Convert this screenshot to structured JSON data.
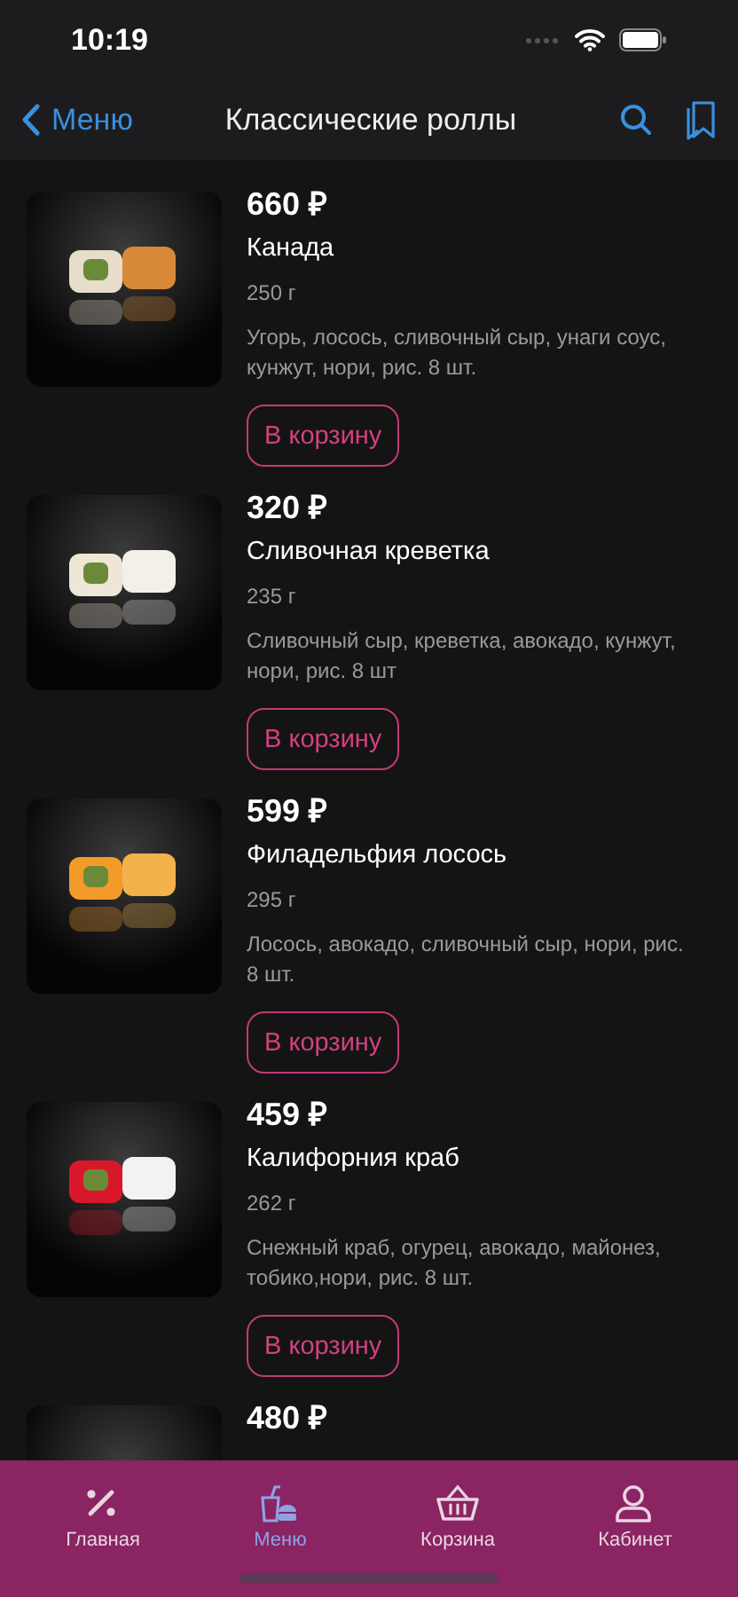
{
  "status_bar": {
    "time": "10:19"
  },
  "nav": {
    "back": "Меню",
    "title": "Классические роллы"
  },
  "products": [
    {
      "price": "660 ₽",
      "name": "Канада",
      "weight": "250 г",
      "description": "Угорь, лосось, сливочный сыр, унаги соус, кунжут, нори, рис. 8 шт.",
      "button": "В корзину"
    },
    {
      "price": "320 ₽",
      "name": "Сливочная креветка",
      "weight": "235 г",
      "description": "Сливочный сыр, креветка, авокадо, кунжут, нори, рис. 8 шт",
      "button": "В корзину"
    },
    {
      "price": "599 ₽",
      "name": "Филадельфия лосось",
      "weight": "295 г",
      "description": "Лосось, авокадо, сливочный сыр, нори, рис. 8 шт.",
      "button": "В корзину"
    },
    {
      "price": "459 ₽",
      "name": "Калифорния краб",
      "weight": "262 г",
      "description": "Снежный краб, огурец, авокадо, майонез, тобико,нори, рис. 8 шт.",
      "button": "В корзину"
    },
    {
      "price": "480 ₽"
    }
  ],
  "tabs": [
    {
      "label": "Главная",
      "kind": "percent",
      "selected": false
    },
    {
      "label": "Меню",
      "kind": "menu",
      "selected": true
    },
    {
      "label": "Корзина",
      "kind": "basket",
      "selected": false
    },
    {
      "label": "Кабинет",
      "kind": "person",
      "selected": false
    }
  ]
}
